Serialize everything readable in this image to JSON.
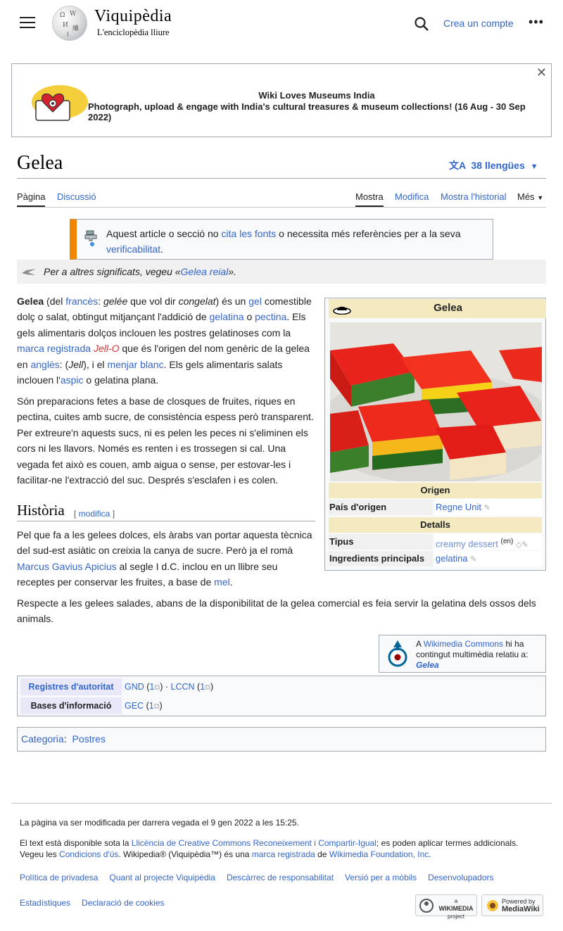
{
  "header": {
    "wordmark": "Viquipèdia",
    "tagline": "L'enciclopèdia lliure",
    "create_account": "Crea un compte",
    "logo_glyphs": [
      "Ω",
      "W",
      "И",
      "維",
      "ا"
    ]
  },
  "banner": {
    "title": "Wiki Loves Museums India",
    "subtitle": "Photograph, upload & engage with India's cultural treasures & museum collections! (16 Aug - 30 Sep 2022)"
  },
  "page": {
    "title": "Gelea",
    "languages": "38 llengües",
    "tabs_left": [
      "Pàgina",
      "Discussió"
    ],
    "tabs_right": [
      "Mostra",
      "Modifica",
      "Mostra l'historial",
      "Més"
    ]
  },
  "ambox": {
    "t1": "Aquest article o secció no ",
    "link1": "cita les fonts",
    "t2": " o necessita més referències per a la seva ",
    "link2": "verificabilitat",
    "t3": "."
  },
  "hatnote": {
    "t1": "Per a altres significats, vegeu «",
    "link": "Gelea reial",
    "t2": "»."
  },
  "intro": {
    "w1": "Gelea",
    "w2": " (del ",
    "l1": "francès",
    "w3": ": ",
    "w4": "gelée",
    "w5": " que vol dir ",
    "w6": "congelat",
    "w7": ") és un ",
    "l2": "gel",
    "w8": " comestible dolç o salat, obtingut mitjançant l'addició de ",
    "l3": "gelatina",
    "w9": " o ",
    "l4": "pectina",
    "w10": ". Els gels alimentaris dolços inclouen les postres gelatinoses com la ",
    "l5": "marca registrada",
    "w11": " ",
    "l6": "Jell-O",
    "w12": " que és l'origen del nom genèric de la gelea en ",
    "l7": "anglès",
    "w13": ": (",
    "w14": "Jell",
    "w15": "), i el ",
    "l8": "menjar blanc",
    "w16": ". Els gels alimentaris salats inclouen l'",
    "l9": "aspic",
    "w17": " o gelatina plana."
  },
  "para2": "Són preparacions fetes a base de closques de fruites, riques en pectina, cuites amb sucre, de consistència espess però transparent. Per extreure'n aquests sucs, ni es pelen les peces ni s'eliminen els cors ni les llavors. Només es renten i es trossegen si cal. Una vegada fet això es couen, amb aigua o sense, per estovar-les i facilitar-ne l'extracció del suc. Després s'esclafen i es colen.",
  "history": {
    "heading": "Història",
    "edit": "modifica",
    "p1a": "Pel que fa a les gelees dolces, els àrabs van portar aquesta tècnica del sud-est asiàtic on creixia la canya de sucre. Però ja el romà ",
    "p1link": "Marcus Gavius Apicius",
    "p1b": " al segle I d.C. inclou en un llibre seu receptes per conservar les fruites, a base de ",
    "p1link2": "mel",
    "p1c": ".",
    "p2": "Respecte a les gelees salades, abans de la disponibilitat de la gelea comercial es feia servir la gelatina dels ossos dels animals."
  },
  "infobox": {
    "title": "Gelea",
    "section_origin": "Origen",
    "country_label": "País d'origen",
    "country_value": "Regne Unit",
    "section_details": "Detalls",
    "type_label": "Tipus",
    "type_value": "creamy dessert",
    "type_lang": "(en)",
    "ingredients_label": "Ingredients principals",
    "ingredients_value": "gelatina"
  },
  "commons": {
    "t1": "A ",
    "link": "Wikimedia Commons",
    "t2": " hi ha contingut multimèdia relatiu a: ",
    "target": "Gelea"
  },
  "authority": {
    "label1": "Registres d'autoritat",
    "v1": [
      "GND",
      "1",
      "LCCN",
      "1"
    ],
    "label2": "Bases d'informació",
    "v2": [
      "GEC",
      "1"
    ]
  },
  "categories": {
    "label": "Categoria",
    "item": "Postres"
  },
  "footer": {
    "modified": "La pàgina va ser modificada per darrera vegada el 9 gen 2022 a les 15:25.",
    "lic_t1": "El text està disponible sota la ",
    "lic_link": "Llicència de Creative Commons Reconeixement i Compartir-Igual",
    "lic_t2": "; es poden aplicar termes addicionals. Vegeu les ",
    "terms_link": "Condicions d'ús",
    "lic_t3": ". Wikipedia® (Viquipèdia™) és una ",
    "tm_link": "marca registrada",
    "lic_t4": " de ",
    "wmf_link": "Wikimedia Foundation, Inc",
    "lic_t5": ".",
    "links1": [
      "Política de privadesa",
      "Quant al projecte Viquipèdia",
      "Descàrrec de responsabilitat",
      "Versió per a mòbils",
      "Desenvolupadors"
    ],
    "links2": [
      "Estadístiques",
      "Declaració de cookies"
    ],
    "badge1": [
      "a",
      "WIKIMEDIA",
      "project"
    ],
    "badge2": [
      "Powered by",
      "MediaWiki"
    ]
  },
  "colors": {
    "link": "#3366cc",
    "redlink": "#d73333",
    "ambox_border": "#f28500",
    "infobox_header": "#f5e9bf"
  }
}
